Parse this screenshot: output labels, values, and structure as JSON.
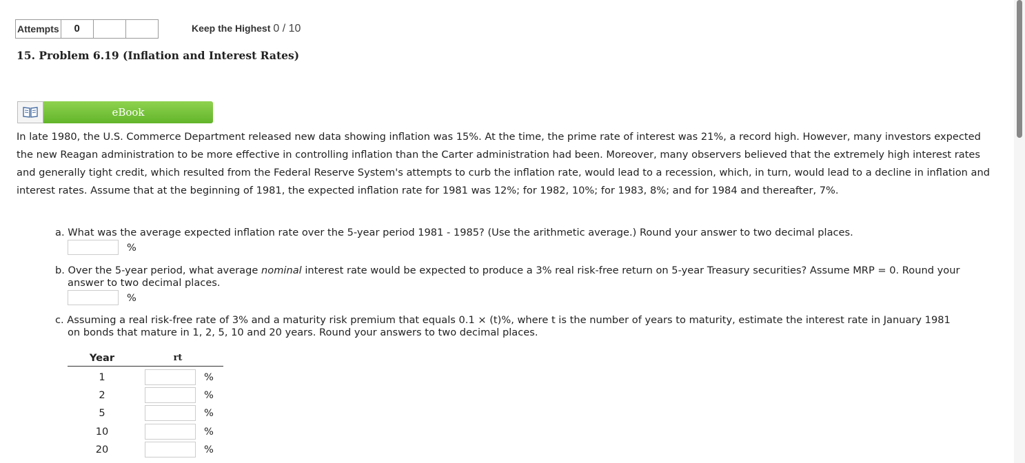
{
  "attempts": {
    "label": "Attempts",
    "value": "0",
    "keep_label": "Keep the Highest",
    "keep_score": "0 / 10"
  },
  "problem": {
    "title": "15.  Problem 6.19 (Inflation and Interest Rates)"
  },
  "ebook": {
    "label": "eBook",
    "icon": "book-icon"
  },
  "intro": "In late 1980, the U.S. Commerce Department released new data showing inflation was 15%. At the time, the prime rate of interest was 21%, a record high. However, many investors expected the new Reagan administration to be more effective in controlling inflation than the Carter administration had been. Moreover, many observers believed that the extremely high interest rates and generally tight credit, which resulted from the Federal Reserve System's attempts to curb the inflation rate, would lead to a recession, which, in turn, would lead to a decline in inflation and interest rates. Assume that at the beginning of 1981, the expected inflation rate for 1981 was 12%; for 1982, 10%; for 1983, 8%; and for 1984 and thereafter, 7%.",
  "questions": {
    "a": {
      "text": "a. What was the average expected inflation rate over the 5-year period 1981 - 1985? (Use the arithmetic average.) Round your answer to two decimal places.",
      "unit": "%",
      "value": ""
    },
    "b": {
      "prefix": "b. Over the 5-year period, what average ",
      "italic": "nominal",
      "suffix": " interest rate would be expected to produce a 3% real risk-free return on 5-year Treasury securities? Assume MRP = 0. Round your",
      "line2": "answer to two decimal places.",
      "unit": "%",
      "value": ""
    },
    "c": {
      "line1": "c. Assuming a real risk-free rate of 3% and a maturity risk premium that equals 0.1 × (t)%, where t is the number of years to maturity, estimate the interest rate in January 1981",
      "line2": "on bonds that mature in 1, 2, 5, 10 and 20 years. Round your answers to two decimal places."
    }
  },
  "table": {
    "col_year": "Year",
    "col_rate": "rt",
    "unit": "%",
    "rows": [
      {
        "year": "1",
        "value": ""
      },
      {
        "year": "2",
        "value": ""
      },
      {
        "year": "5",
        "value": ""
      },
      {
        "year": "10",
        "value": ""
      },
      {
        "year": "20",
        "value": ""
      }
    ]
  },
  "colors": {
    "ebook_green": "#62b52a",
    "scroll_thumb": "#888888"
  }
}
